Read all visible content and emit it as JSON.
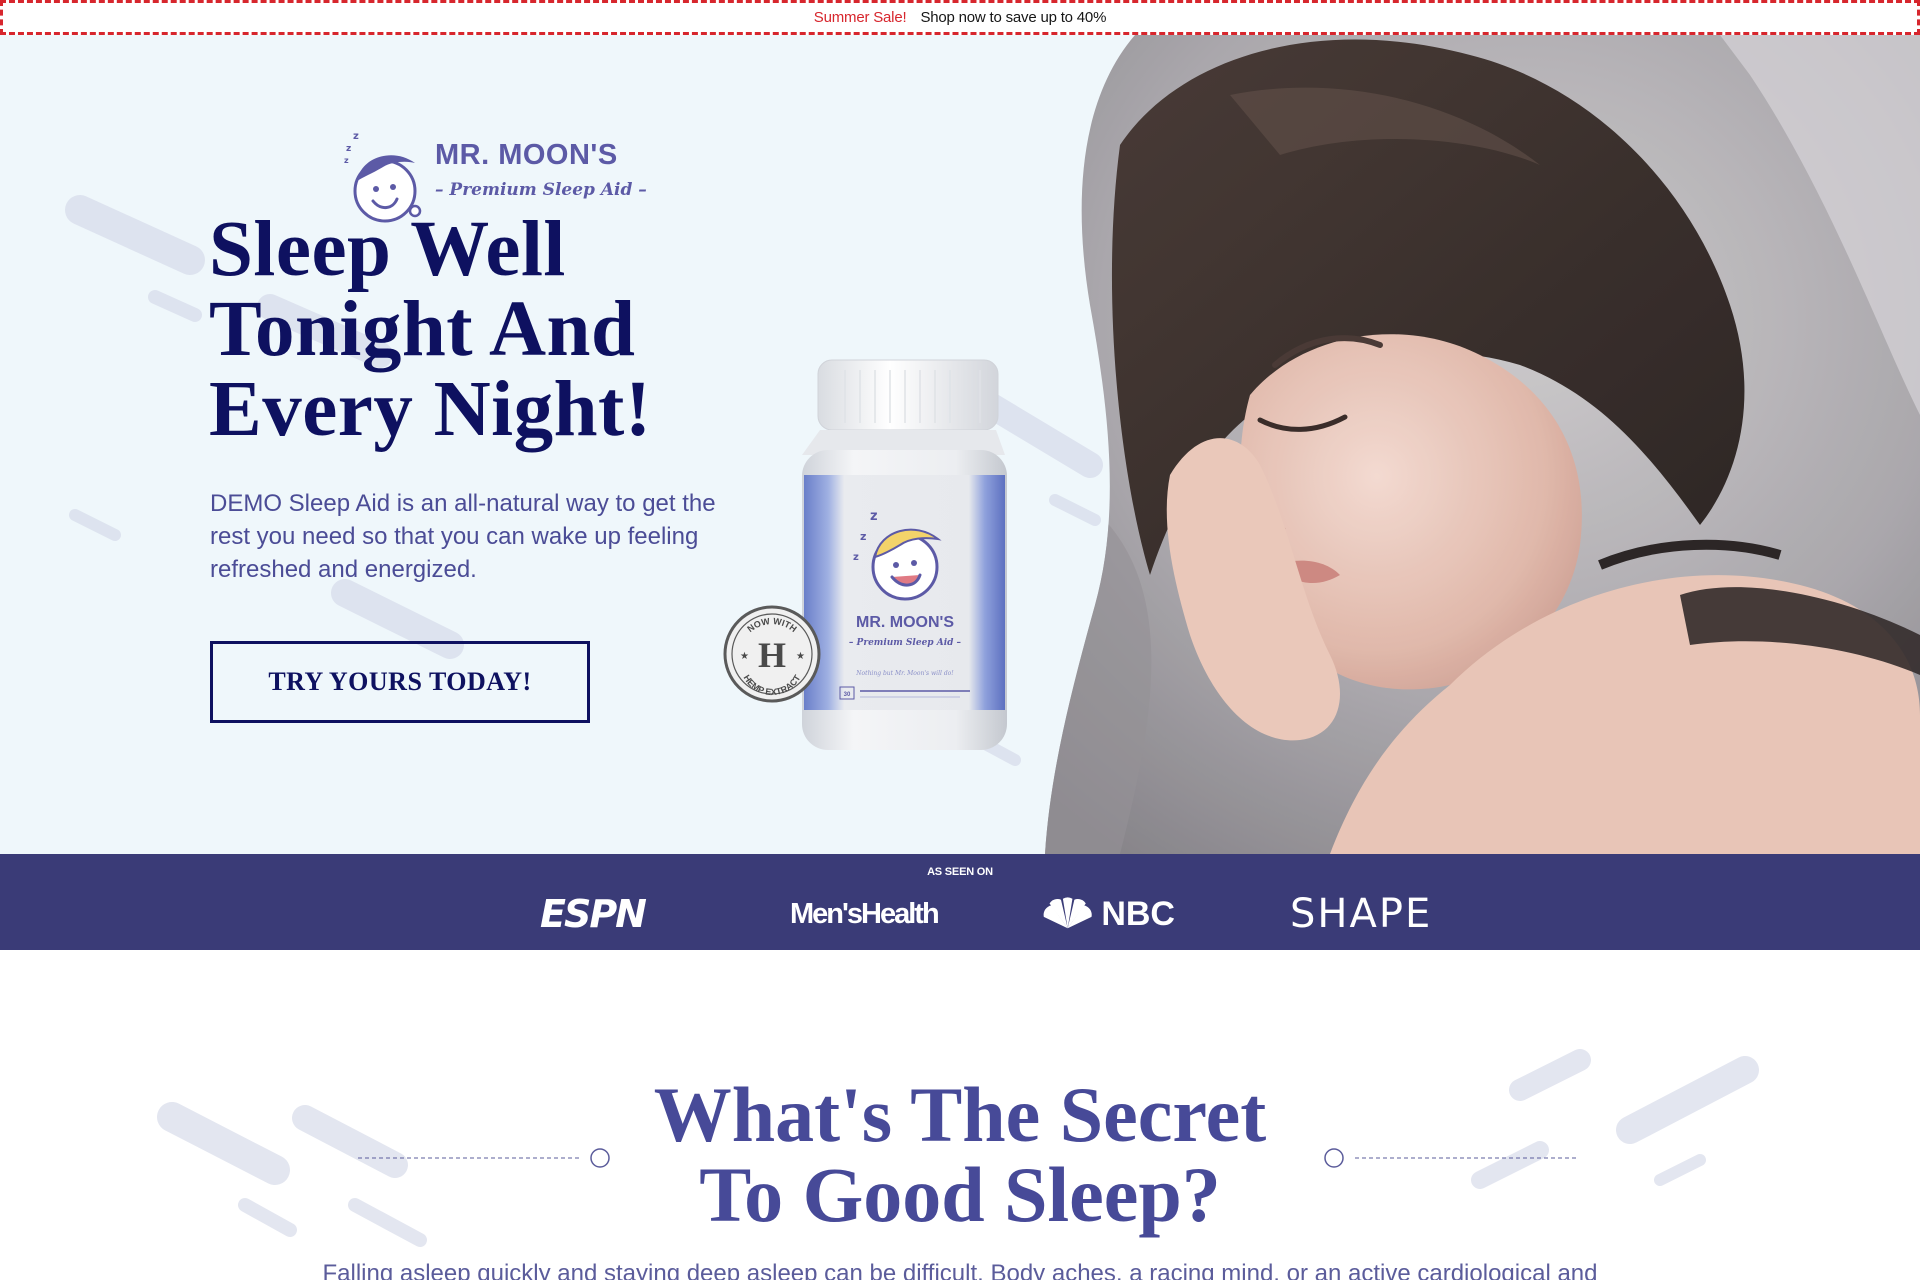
{
  "announcement": {
    "sale_label": "Summer Sale!",
    "message": "Shop now to save up to 40%"
  },
  "brand": {
    "name": "MR. MOON'S",
    "tagline": "– Premium Sleep Aid –"
  },
  "hero": {
    "headline_lines": [
      "Sleep Well",
      "Tonight And",
      "Every Night!"
    ],
    "subcopy": "DEMO Sleep Aid is an all-natural way to get the rest you need so that you can wake up feeling refreshed and energized.",
    "cta_label": "TRY YOURS TODAY!",
    "product": {
      "badge_top": "NOW WITH",
      "badge_letter": "H",
      "badge_bottom": "HEMP EXTRACT",
      "label_name": "MR. MOON'S",
      "label_tagline": "– Premium Sleep Aid –",
      "label_small": "Nothing but Mr. Moon's will do!",
      "count": "30"
    }
  },
  "press": {
    "label": "AS SEEN ON",
    "logos": [
      {
        "name": "espn-logo",
        "text": "ESPN"
      },
      {
        "name": "mens-health-logo",
        "text": "Men'sHealth"
      },
      {
        "name": "nbc-logo",
        "text": "NBC"
      },
      {
        "name": "shape-logo",
        "text": "SHAPE"
      }
    ]
  },
  "secret": {
    "title_lines": [
      "What's The Secret",
      "To Good Sleep?"
    ],
    "body": "Falling asleep quickly and staying deep asleep can be difficult. Body aches, a racing mind, or an active cardiological and"
  },
  "colors": {
    "navy": "#0e1160",
    "brand_purple": "#5c5aa6",
    "press_bar": "#3a3b77",
    "sale_red": "#d7262d",
    "hero_bg": "#eff7fb"
  }
}
